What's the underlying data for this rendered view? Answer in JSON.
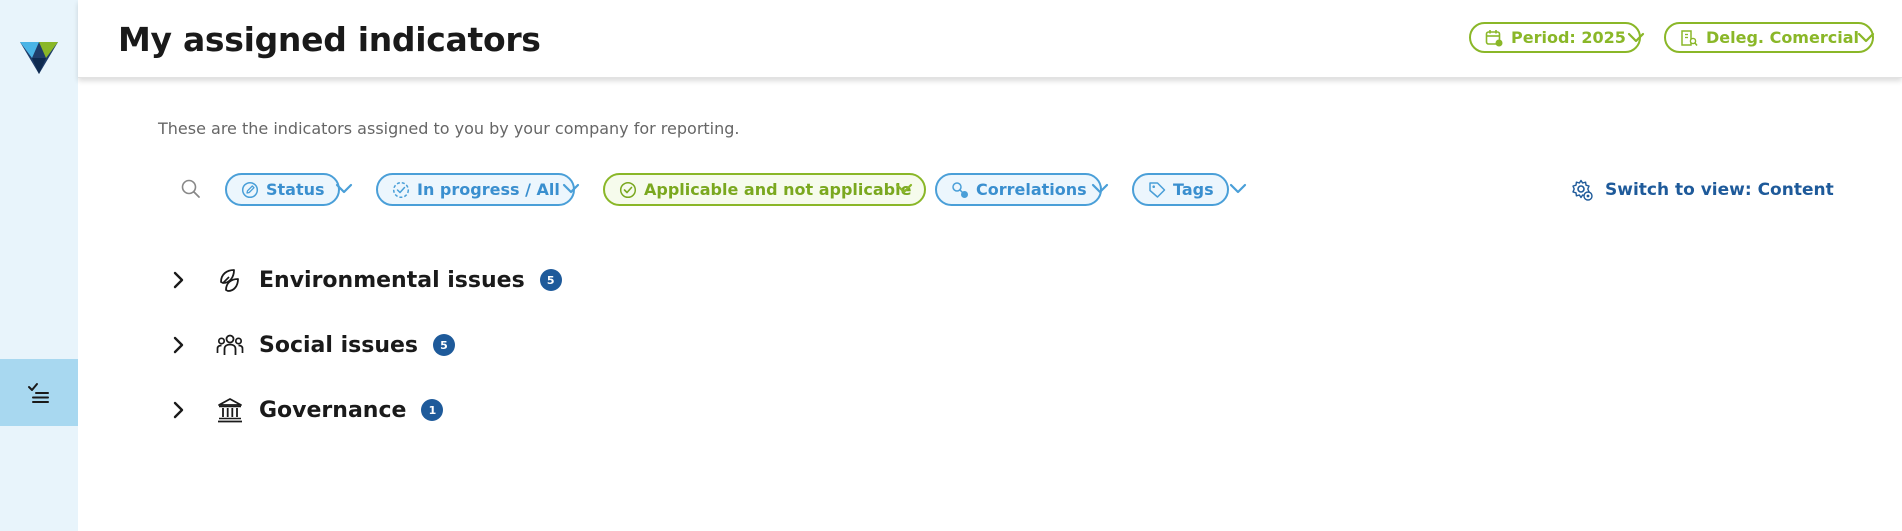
{
  "header": {
    "title": "My assigned indicators",
    "period_label": "Period: 2025",
    "delegation_label": "Deleg. Comercial"
  },
  "colors": {
    "accent_green": "#8ab728",
    "accent_blue": "#4a9fd8",
    "badge_navy": "#1e5a9a",
    "sidebar_bg": "#e8f4fb",
    "sidebar_active_bg": "#a8d8f0"
  },
  "sidebar": {
    "items": [
      {
        "icon": "checklist-icon",
        "active": true
      }
    ]
  },
  "main": {
    "subtitle": "These are the indicators assigned to you by your company for reporting.",
    "filters": [
      {
        "label": "Status",
        "icon": "edit-circle-icon"
      },
      {
        "label": "In progress / All",
        "icon": "progress-icon"
      },
      {
        "label": "Applicable and not applicable",
        "icon": "check-circle-icon"
      },
      {
        "label": "Correlations",
        "icon": "correlation-icon"
      },
      {
        "label": "Tags",
        "icon": "tag-icon"
      }
    ],
    "switch_view": "Switch to view: Content",
    "categories": [
      {
        "label": "Environmental issues",
        "count": "5",
        "icon": "leaf-icon"
      },
      {
        "label": "Social issues",
        "count": "5",
        "icon": "people-icon"
      },
      {
        "label": "Governance",
        "count": "1",
        "icon": "building-icon"
      }
    ]
  }
}
